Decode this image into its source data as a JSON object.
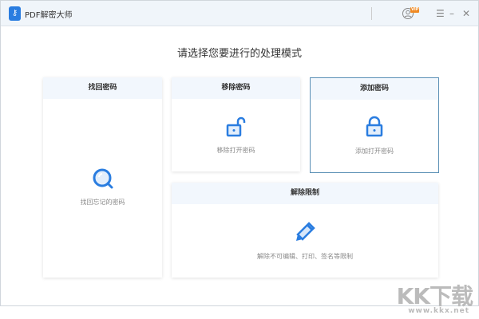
{
  "app": {
    "title": "PDF解密大师",
    "badge": "VIP"
  },
  "heading": "请选择您要进行的处理模式",
  "cards": [
    {
      "title": "找回密码",
      "desc": "找回忘记的密码",
      "icon": "search-icon"
    },
    {
      "title": "移除密码",
      "desc": "移除打开密码",
      "icon": "unlock-icon"
    },
    {
      "title": "添加密码",
      "desc": "添加打开密码",
      "icon": "lock-icon"
    },
    {
      "title": "解除限制",
      "desc": "解除不可编辑、打印、签名等限制",
      "icon": "pencil-icon"
    }
  ],
  "watermark": {
    "text": "KK下载",
    "url": "www.kkx.net"
  },
  "colors": {
    "accent": "#2a7de0",
    "header": "#f2f7fd"
  }
}
